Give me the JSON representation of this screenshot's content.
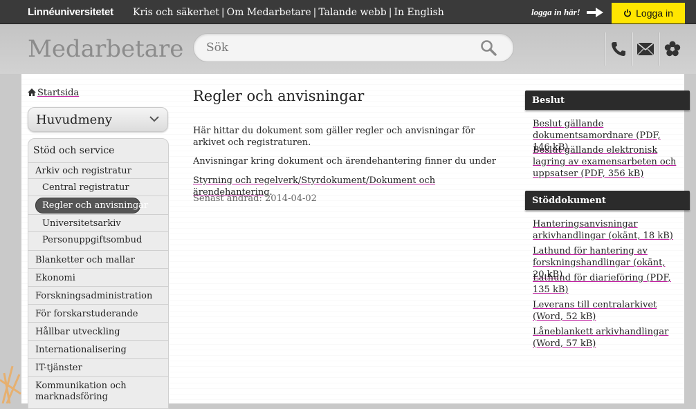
{
  "topbar": {
    "logo": "Linnéuniversitetet",
    "links": [
      "Kris och säkerhet",
      "Om Medarbetare",
      "Talande webb",
      "In English"
    ],
    "separator": "|",
    "login_hint": "logga in här!",
    "login_label": "Logga in",
    "login_color": "#ffe600"
  },
  "header": {
    "title": "Medarbetare",
    "search_placeholder": "Sök",
    "icons": [
      "phone-icon",
      "mail-icon",
      "flower-icon"
    ]
  },
  "sidebar": {
    "home": "Startsida",
    "main_menu": "Huvudmeny",
    "items": [
      {
        "label": "Stöd och service"
      },
      {
        "label": "Arkiv och registratur"
      },
      {
        "label": "Central registratur"
      },
      {
        "label": "Regler och anvisningar",
        "selected": true
      },
      {
        "label": "Universitetsarkiv"
      },
      {
        "label": "Personuppgiftsombud"
      },
      {
        "label": "Blanketter och mallar"
      },
      {
        "label": "Ekonomi"
      },
      {
        "label": "Forskningsadministration"
      },
      {
        "label": "För forskarstuderande"
      },
      {
        "label": "Hållbar utveckling"
      },
      {
        "label": "Internationalisering"
      },
      {
        "label": "IT-tjänster"
      },
      {
        "label": "Kommunikation och marknadsföring"
      }
    ]
  },
  "main": {
    "title": "Regler och anvisningar",
    "paragraphs": [
      "Här hittar du dokument som gäller regler och anvisningar för arkivet och registraturen.",
      "Anvisningar kring dokument och ärendehantering finner du under"
    ],
    "link": "Styrning och regelverk/Styrdokument/Dokument och ärendehantering",
    "link_suffix": ".",
    "updated": "Senast ändrad: 2014-04-02"
  },
  "right": {
    "beslut": {
      "title": "Beslut",
      "links": [
        "Beslut gällande dokumentsamordnare (PDF, 146 kB)",
        "Beslut gällande elektronisk lagring av examensarbeten och uppsatser (PDF, 356 kB)"
      ]
    },
    "stod": {
      "title": "Stöddokument",
      "links": [
        "Hanteringsanvisningar arkivhandlingar (okänt, 18 kB)",
        "Lathund för hantering av forskningshandlingar (okänt, 20 kB)",
        "Lathund för diarieföring (PDF, 135 kB)",
        "Leverans till centralarkivet (Word, 52 kB)",
        "Låneblankett arkivhandlingar (Word, 57 kB)"
      ]
    }
  }
}
